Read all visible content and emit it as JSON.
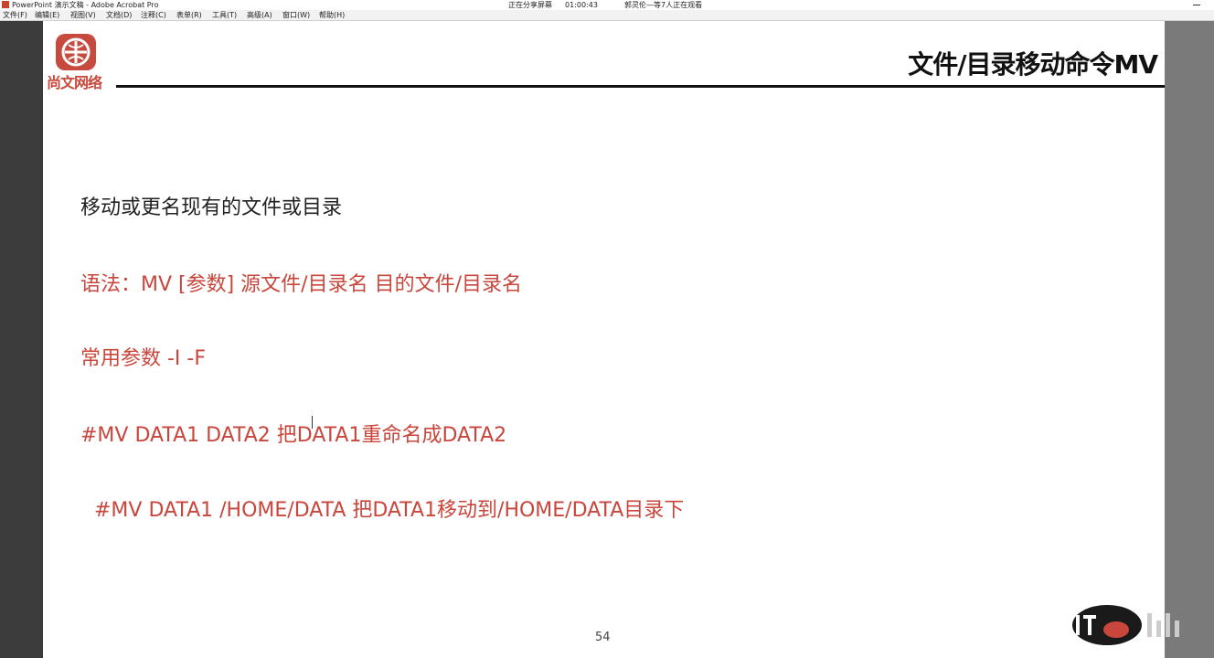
{
  "window": {
    "title": "PowerPoint 演示文稿 - Adobe Acrobat Pro",
    "status": "正在分享屏幕",
    "timer": "01:00:43",
    "viewers": "郭灵伦—等7人正在观看"
  },
  "menu": [
    "文件(F)",
    "编辑(E)",
    "视图(V)",
    "文档(D)",
    "注释(C)",
    "表单(R)",
    "工具(T)",
    "高级(A)",
    "窗口(W)",
    "帮助(H)"
  ],
  "slide": {
    "logo_text": "尚文网络",
    "title": "文件/目录移动命令MV",
    "description": "移动或更名现有的文件或目录",
    "syntax": "语法：MV [参数] 源文件/目录名 目的文件/目录名",
    "params": "常用参数  -I    -F",
    "example1": "#MV DATA1  DATA2  把DATA1重命名成DATA2",
    "example2": "#MV DATA1  /HOME/DATA 把DATA1移动到/HOME/DATA目录下",
    "page_number": "54"
  },
  "colors": {
    "accent_red": "#c8463c",
    "logo_red": "#c64a3e",
    "text_dark": "#222222"
  }
}
